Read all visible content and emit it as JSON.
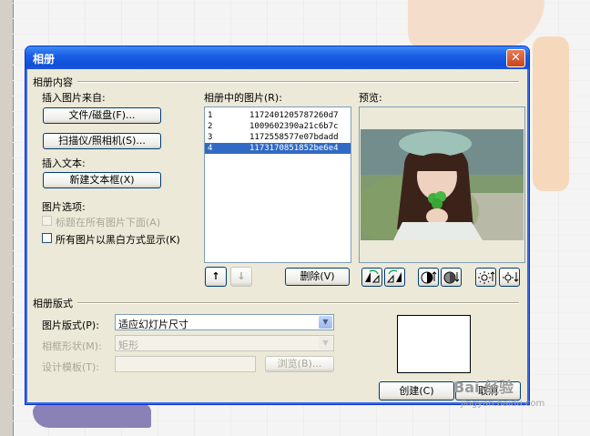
{
  "dialog": {
    "title": "相册",
    "close_glyph": "✕"
  },
  "content_section": {
    "title": "相册内容",
    "insert_picture_from": "插入图片来自:",
    "file_disk_button": "文件/磁盘(F)...",
    "scanner_camera_button": "扫描仪/照相机(S)...",
    "insert_text": "插入文本:",
    "new_textbox_button": "新建文本框(X)",
    "picture_options": "图片选项:",
    "captions_below_all": "标题在所有图片下面(A)",
    "all_black_white": "所有图片以黑白方式显示(K)"
  },
  "pictures": {
    "label": "相册中的图片(R):",
    "items": [
      {
        "num": "1",
        "name": "1172401205787260d7",
        "selected": false
      },
      {
        "num": "2",
        "name": "1009602390a21c6b7c",
        "selected": false
      },
      {
        "num": "3",
        "name": "1172558577e07bdadd",
        "selected": false
      },
      {
        "num": "4",
        "name": "1173170851852be6e4",
        "selected": true
      }
    ],
    "move_up_glyph": "↑",
    "move_down_glyph": "↓",
    "delete_button": "删除(V)"
  },
  "preview": {
    "label": "预览:"
  },
  "layout_section": {
    "title": "相册版式",
    "picture_layout_label": "图片版式(P):",
    "picture_layout_value": "适应幻灯片尺寸",
    "frame_shape_label": "相框形状(M):",
    "frame_shape_value": "矩形",
    "design_template_label": "设计模板(T):",
    "design_template_value": "",
    "browse_button": "浏览(B)..."
  },
  "footer": {
    "create_button": "创建(C)",
    "cancel_button": "取消"
  },
  "background": {
    "watermark": "Bai 经验",
    "watermark_url": "jingyan.baidu.com"
  },
  "colors": {
    "titlebar": "#0f4fd8",
    "dialog_bg": "#ece9d8",
    "selection": "#316ac5"
  }
}
